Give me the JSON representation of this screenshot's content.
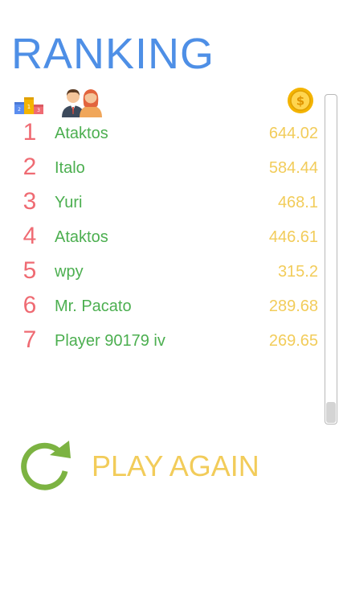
{
  "title": "RANKING",
  "header": {
    "rank_icon": "podium-icon",
    "player_icon": "users-icon",
    "score_icon": "coin-icon"
  },
  "rows": [
    {
      "rank": "1",
      "name": "Ataktos",
      "score": "644.02"
    },
    {
      "rank": "2",
      "name": "Italo",
      "score": "584.44"
    },
    {
      "rank": "3",
      "name": "Yuri",
      "score": "468.1"
    },
    {
      "rank": "4",
      "name": "Ataktos",
      "score": "446.61"
    },
    {
      "rank": "5",
      "name": "wpy",
      "score": "315.2"
    },
    {
      "rank": "6",
      "name": "Mr. Pacato",
      "score": "289.68"
    },
    {
      "rank": "7",
      "name": "Player 90179 iv",
      "score": "269.65"
    }
  ],
  "play_again": {
    "label": "PLAY AGAIN",
    "icon": "refresh-icon"
  },
  "colors": {
    "title": "#4e8fe6",
    "rank": "#ef6b73",
    "name": "#4caf50",
    "score": "#f2cc5a",
    "refresh": "#7cb342"
  }
}
